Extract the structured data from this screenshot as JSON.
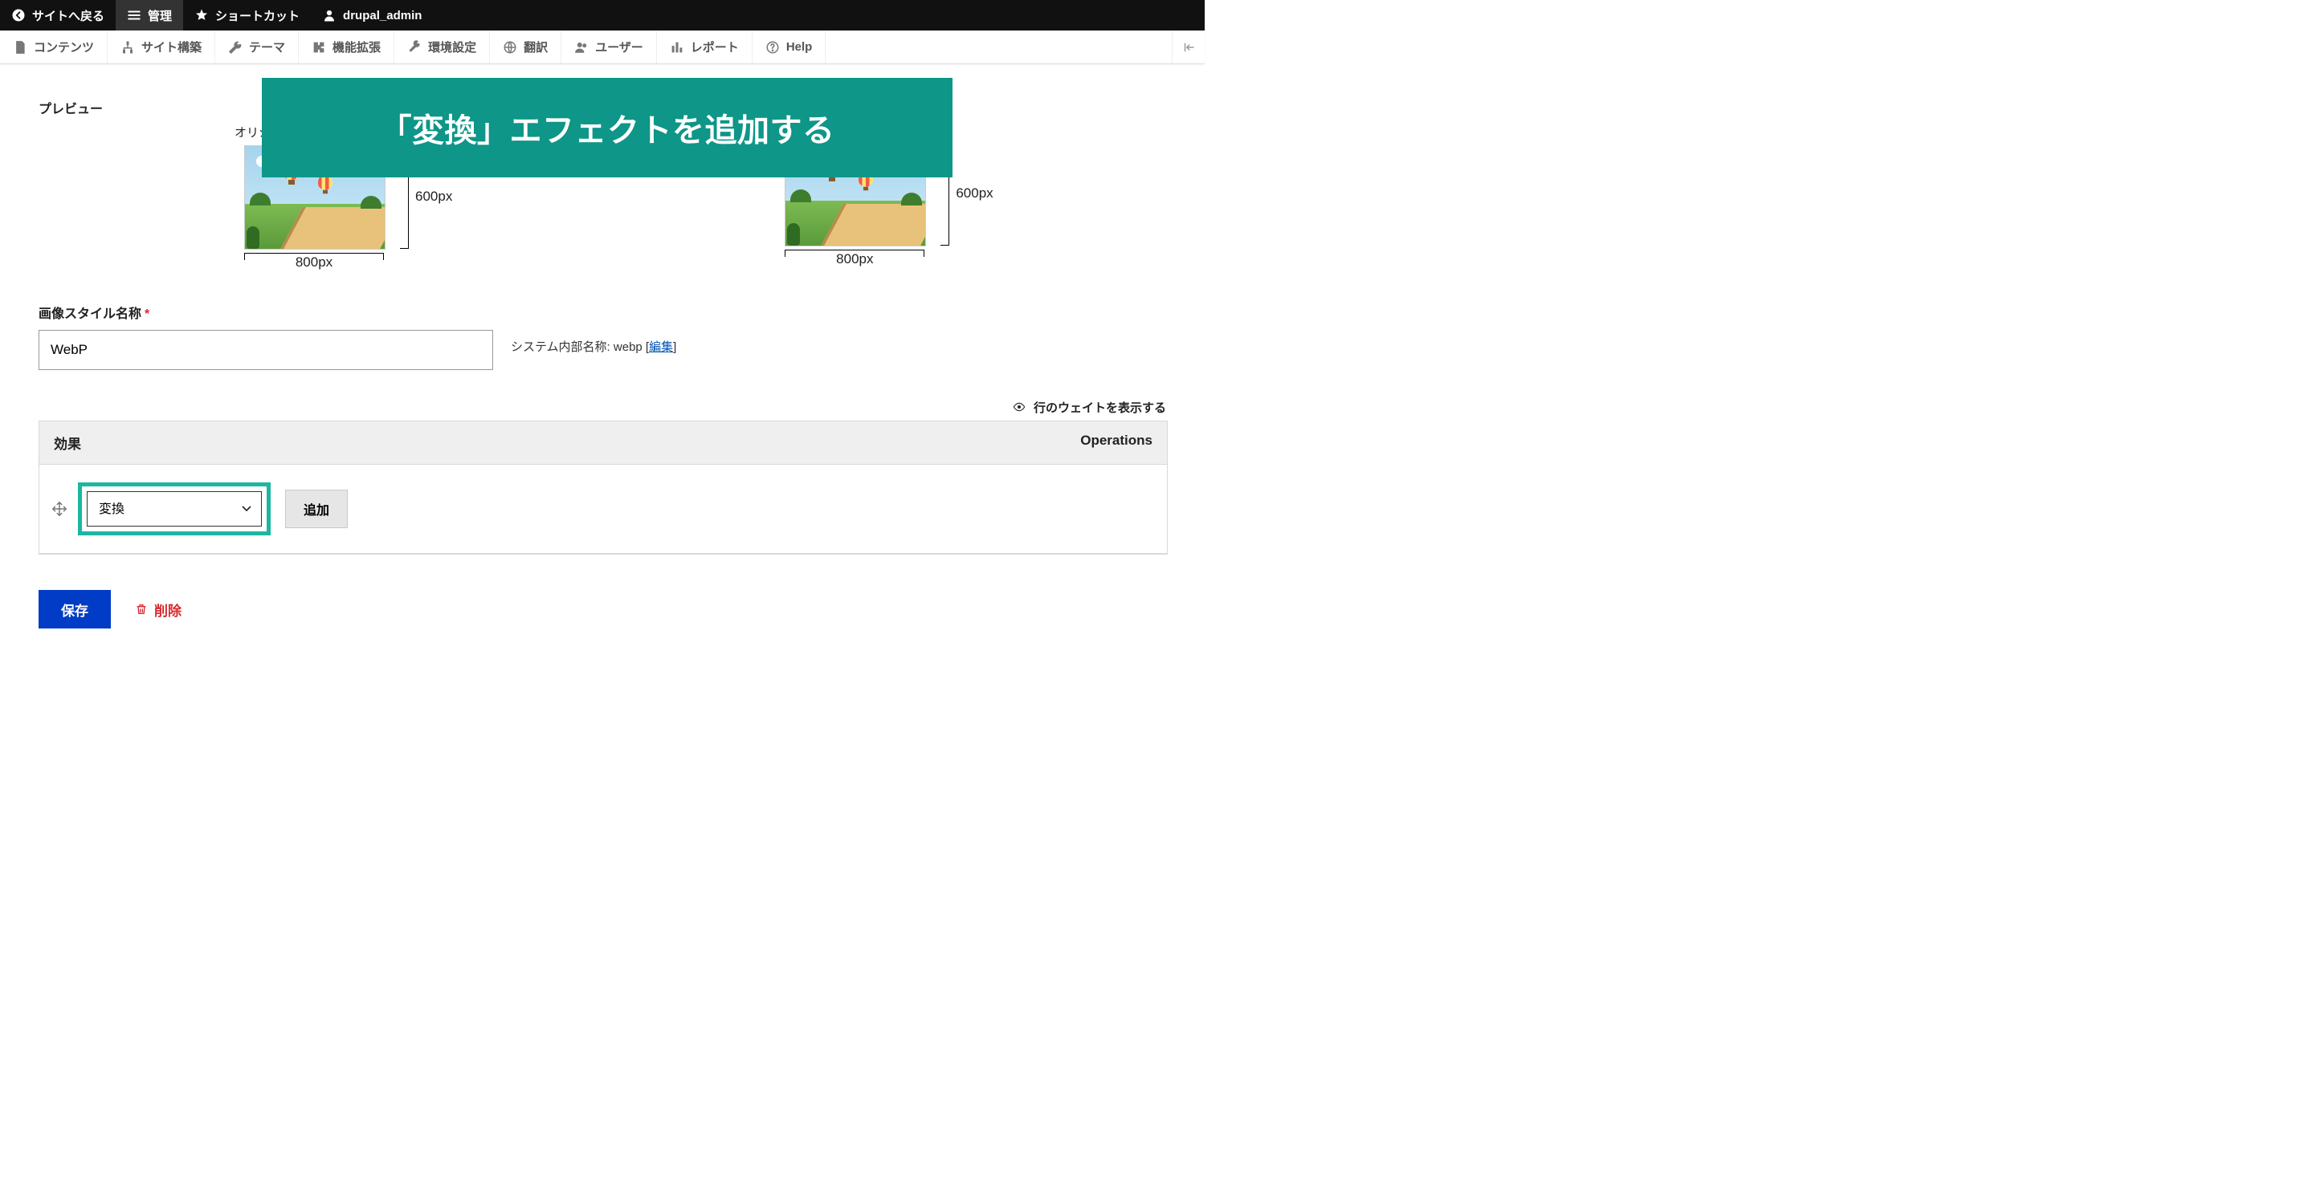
{
  "topbar": {
    "back_label": "サイトへ戻る",
    "manage_label": "管理",
    "shortcuts_label": "ショートカット",
    "user_label": "drupal_admin"
  },
  "adminbar": {
    "items": [
      {
        "label": "コンテンツ"
      },
      {
        "label": "サイト構築"
      },
      {
        "label": "テーマ"
      },
      {
        "label": "機能拡張"
      },
      {
        "label": "環境設定"
      },
      {
        "label": "翻訳"
      },
      {
        "label": "ユーザー"
      },
      {
        "label": "レポート"
      },
      {
        "label": "Help"
      }
    ]
  },
  "teal_banner_text": "「変換」エフェクトを追加する",
  "preview": {
    "section_label": "プレビュー",
    "original_caption": "オリシ",
    "width_label": "800px",
    "height_label": "600px"
  },
  "style_name": {
    "label": "画像スタイル名称",
    "required_mark": "*",
    "value": "WebP",
    "machine_name_prefix": "システム内部名称: ",
    "machine_name_value": "webp",
    "edit_link_open": "[",
    "edit_link_text": "編集",
    "edit_link_close": "]"
  },
  "weights_toggle_label": "行のウェイトを表示する",
  "table": {
    "col_effect": "効果",
    "col_ops": "Operations",
    "select_value": "変換",
    "add_button": "追加"
  },
  "actions": {
    "save_label": "保存",
    "delete_label": "削除"
  }
}
